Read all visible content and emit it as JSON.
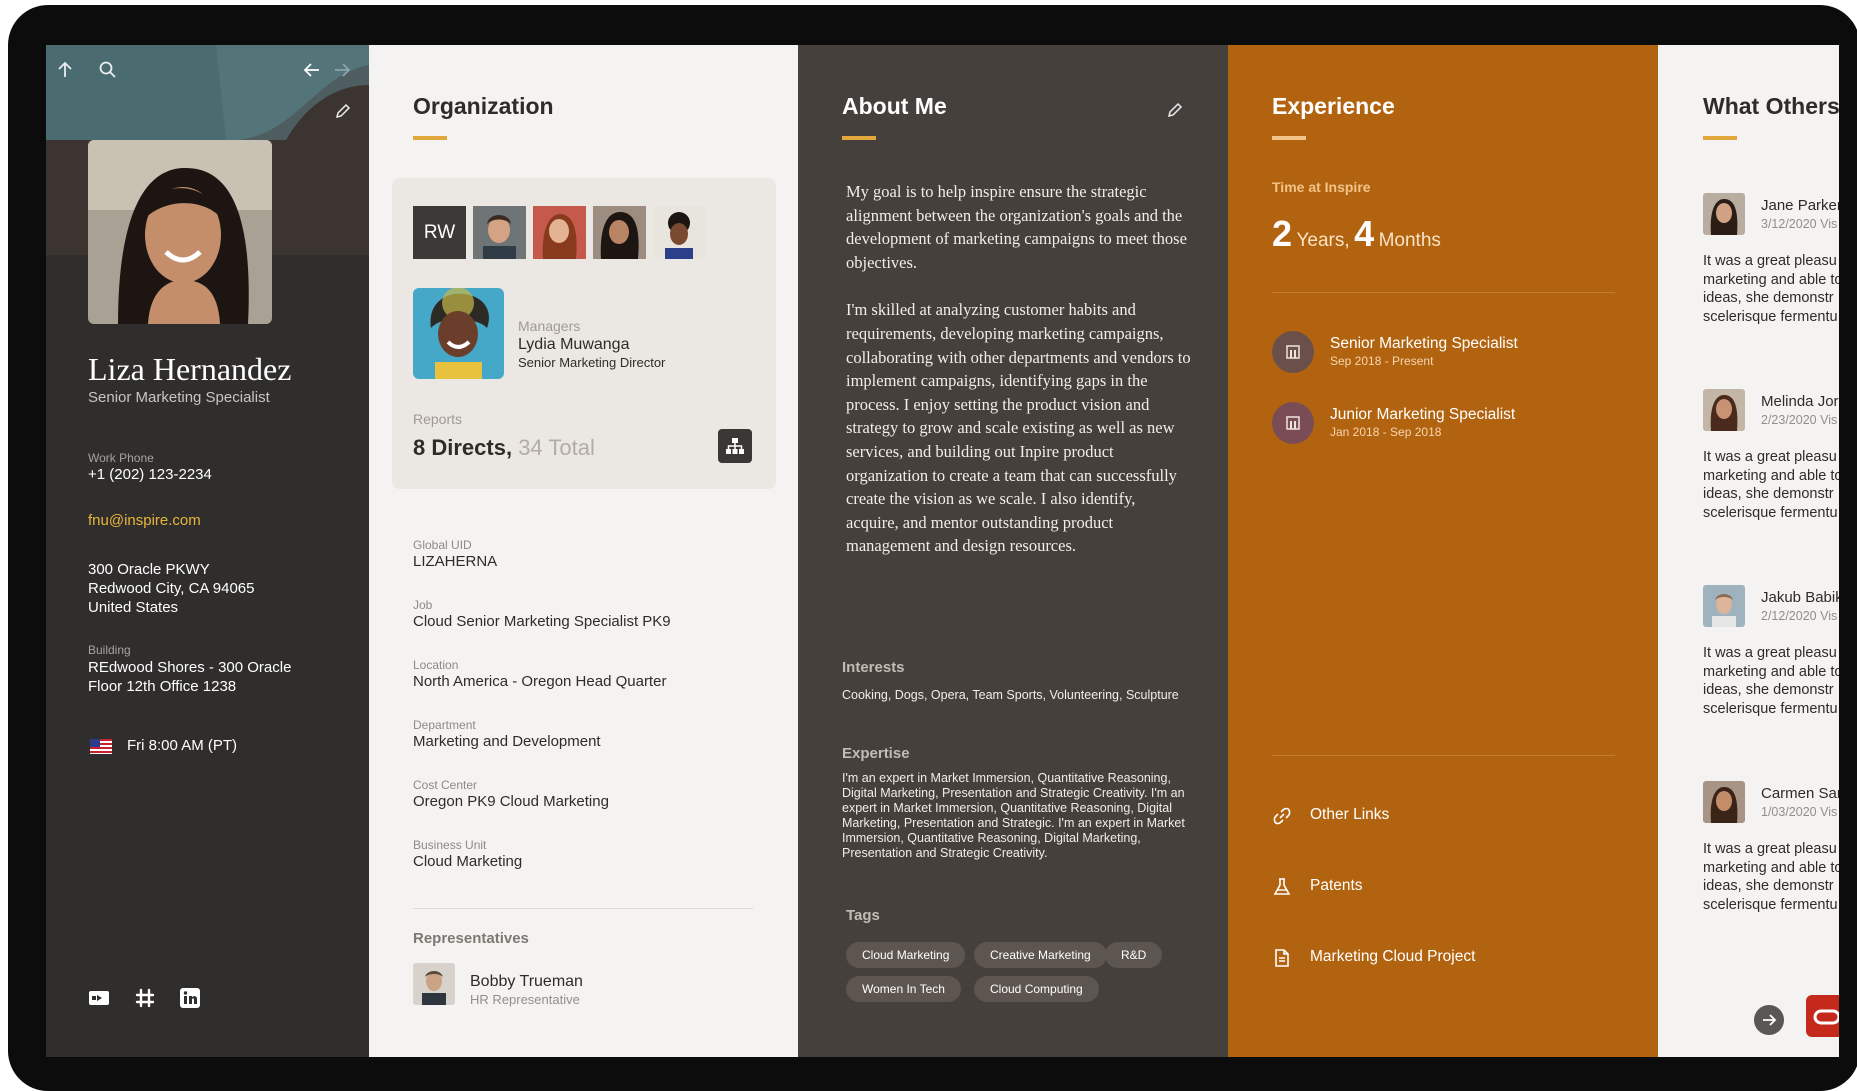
{
  "profile": {
    "name": "Liza Hernandez",
    "title": "Senior Marketing Specialist",
    "work_phone_label": "Work Phone",
    "work_phone": "+1 (202) 123-2234",
    "email": "fnu@inspire.com",
    "address_line1": "300 Oracle PKWY",
    "address_line2": "Redwood City, CA 94065",
    "address_line3": "United States",
    "building_label": "Building",
    "building_line1": "REdwood Shores - 300 Oracle",
    "building_line2": "Floor 12th Office 1238",
    "local_time": "Fri 8:00 AM (PT)",
    "social_icons": [
      "video-icon",
      "slack-icon",
      "linkedin-icon"
    ]
  },
  "organization": {
    "title": "Organization",
    "team_initials": "RW",
    "managers_label": "Managers",
    "manager_name": "Lydia Muwanga",
    "manager_title": "Senior Marketing Director",
    "reports_label": "Reports",
    "reports_directs": "8 Directs,",
    "reports_total": "34 Total",
    "fields": [
      {
        "label": "Global UID",
        "value": "LIZAHERNA"
      },
      {
        "label": "Job",
        "value": "Cloud Senior Marketing Specialist PK9"
      },
      {
        "label": "Location",
        "value": "North America - Oregon Head Quarter"
      },
      {
        "label": "Department",
        "value": "Marketing and Development"
      },
      {
        "label": "Cost Center",
        "value": "Oregon PK9 Cloud Marketing"
      },
      {
        "label": "Business Unit",
        "value": "Cloud Marketing"
      }
    ],
    "representatives_label": "Representatives",
    "rep_name": "Bobby Trueman",
    "rep_title": "HR Representative"
  },
  "about": {
    "title": "About Me",
    "paragraph1": "My goal is to help inspire ensure the strategic alignment between the organization's goals and the development of marketing campaigns to meet those objectives.",
    "paragraph2": "I'm skilled at analyzing customer habits and requirements, developing marketing campaigns, collaborating with other departments and vendors to implement campaigns, identifying gaps in the process. I enjoy setting the product vision and strategy to grow and scale existing as well as new services, and building out Inpire product organization to create a team that can successfully create the vision as we scale. I also identify, acquire, and mentor outstanding product management and design resources.",
    "interests_label": "Interests",
    "interests": "Cooking, Dogs, Opera, Team Sports, Volunteering, Sculpture",
    "expertise_label": "Expertise",
    "expertise": "I'm an expert in Market Immersion, Quantitative Reasoning, Digital Marketing, Presentation and Strategic Creativity. I'm an expert in Market Immersion, Quantitative Reasoning, Digital Marketing, Presentation and Strategic. I'm an expert in Market Immersion, Quantitative Reasoning, Digital Marketing, Presentation and Strategic Creativity.",
    "tags_label": "Tags",
    "tags": [
      "Cloud Marketing",
      "Creative Marketing",
      "R&D",
      "Women In Tech",
      "Cloud Computing"
    ]
  },
  "experience": {
    "title": "Experience",
    "time_label": "Time at Inspire",
    "years": "2",
    "years_unit": "Years,",
    "months": "4",
    "months_unit": "Months",
    "roles": [
      {
        "title": "Senior Marketing Specialist",
        "dates": "Sep 2018 - Present"
      },
      {
        "title": "Junior Marketing Specialist",
        "dates": "Jan 2018 - Sep 2018"
      }
    ],
    "links": [
      {
        "label": "Other Links",
        "icon": "link-icon"
      },
      {
        "label": "Patents",
        "icon": "flask-icon"
      },
      {
        "label": "Marketing Cloud Project",
        "icon": "document-icon"
      }
    ]
  },
  "others": {
    "title": "What Others",
    "reviews": [
      {
        "name": "Jane Parker",
        "date": "3/12/2020 Vis",
        "text": "It was a great pleasu the digital marketing and able to contribu ideas, she demonstr scelerisque fermentu"
      },
      {
        "name": "Melinda Jor",
        "date": "2/23/2020 Vis",
        "text": "It was a great pleasu the digital marketing and able to contribu ideas, she demonstr scelerisque fermentu"
      },
      {
        "name": "Jakub Babik",
        "date": "2/12/2020 Vis",
        "text": "It was a great pleasu the digital marketing and able to contribu ideas, she demonstr scelerisque fermentu"
      },
      {
        "name": "Carmen San",
        "date": "1/03/2020 Vis",
        "text": "It was a great pleasu the digital marketing and able to contribu ideas, she demonstr scelerisque fermentu"
      }
    ]
  },
  "colors": {
    "profile_bg": "#302e2c",
    "org_bg": "#f4f3f1",
    "about_bg": "#45403c",
    "experience_bg": "#b2630f",
    "accent_gold": "#e3a83b",
    "email_gold": "#e7b53c",
    "brand_red": "#c5291c"
  }
}
